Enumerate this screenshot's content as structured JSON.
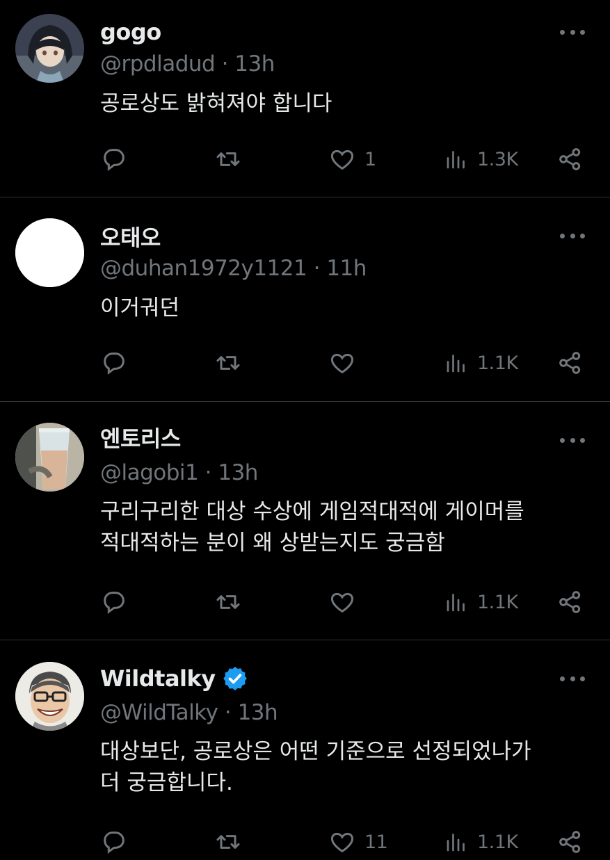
{
  "theme": {
    "background": "#000000",
    "text": "#e7e9ea",
    "secondary": "#71767b",
    "divider": "#2f3336",
    "verified": "#1d9bf0"
  },
  "tweets": [
    {
      "display_name": "gogo",
      "handle": "@rpdladud",
      "separator": "·",
      "time": "13h",
      "text": "공로상도 밝혀져야 합니다",
      "avatar": "anime-character-avatar",
      "verified": false,
      "actions": {
        "reply_icon": "reply-icon",
        "retweet_icon": "retweet-icon",
        "like_icon": "heart-icon",
        "likes": "1",
        "views_icon": "views-icon",
        "views": "1.3K",
        "share_icon": "share-icon"
      }
    },
    {
      "display_name": "오태오",
      "handle": "@duhan1972y1121",
      "separator": "·",
      "time": "11h",
      "text": "이거궈던",
      "avatar": "blank-white-avatar",
      "verified": false,
      "actions": {
        "reply_icon": "reply-icon",
        "retweet_icon": "retweet-icon",
        "like_icon": "heart-icon",
        "likes": "",
        "views_icon": "views-icon",
        "views": "1.1K",
        "share_icon": "share-icon"
      }
    },
    {
      "display_name": "엔토리스",
      "handle": "@lagobi1",
      "separator": "·",
      "time": "13h",
      "text_lines": [
        "구리구리한 대상 수상에 게임적대적에 게이머를",
        "적대적하는 분이 왜 상받는지도 궁금함"
      ],
      "avatar": "drink-cup-photo-avatar",
      "verified": false,
      "actions": {
        "reply_icon": "reply-icon",
        "retweet_icon": "retweet-icon",
        "like_icon": "heart-icon",
        "likes": "",
        "views_icon": "views-icon",
        "views": "1.1K",
        "share_icon": "share-icon"
      }
    },
    {
      "display_name": "Wildtalky",
      "handle": "@WildTalky",
      "separator": "·",
      "time": "13h",
      "text_lines": [
        "대상보단, 공로상은 어떤 기준으로 선정되었나가",
        "더 궁금합니다."
      ],
      "avatar": "cartoon-man-glasses-avatar",
      "verified": true,
      "actions": {
        "reply_icon": "reply-icon",
        "retweet_icon": "retweet-icon",
        "like_icon": "heart-icon",
        "likes": "11",
        "views_icon": "views-icon",
        "views": "1.1K",
        "share_icon": "share-icon"
      }
    }
  ]
}
